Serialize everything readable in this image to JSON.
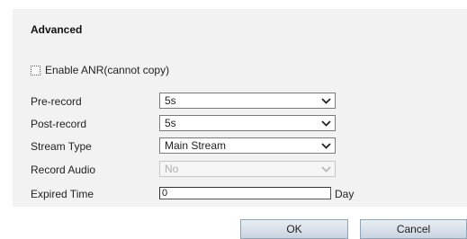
{
  "section": {
    "title": "Advanced"
  },
  "anr": {
    "label": "Enable ANR(cannot copy)",
    "checked": false
  },
  "fields": {
    "pre_record": {
      "label": "Pre-record",
      "value": "5s"
    },
    "post_record": {
      "label": "Post-record",
      "value": "5s"
    },
    "stream_type": {
      "label": "Stream Type",
      "value": "Main Stream"
    },
    "record_audio": {
      "label": "Record Audio",
      "value": "No",
      "disabled": true
    },
    "expired_time": {
      "label": "Expired Time",
      "value": "0",
      "unit": "Day"
    }
  },
  "buttons": {
    "ok": "OK",
    "cancel": "Cancel"
  }
}
